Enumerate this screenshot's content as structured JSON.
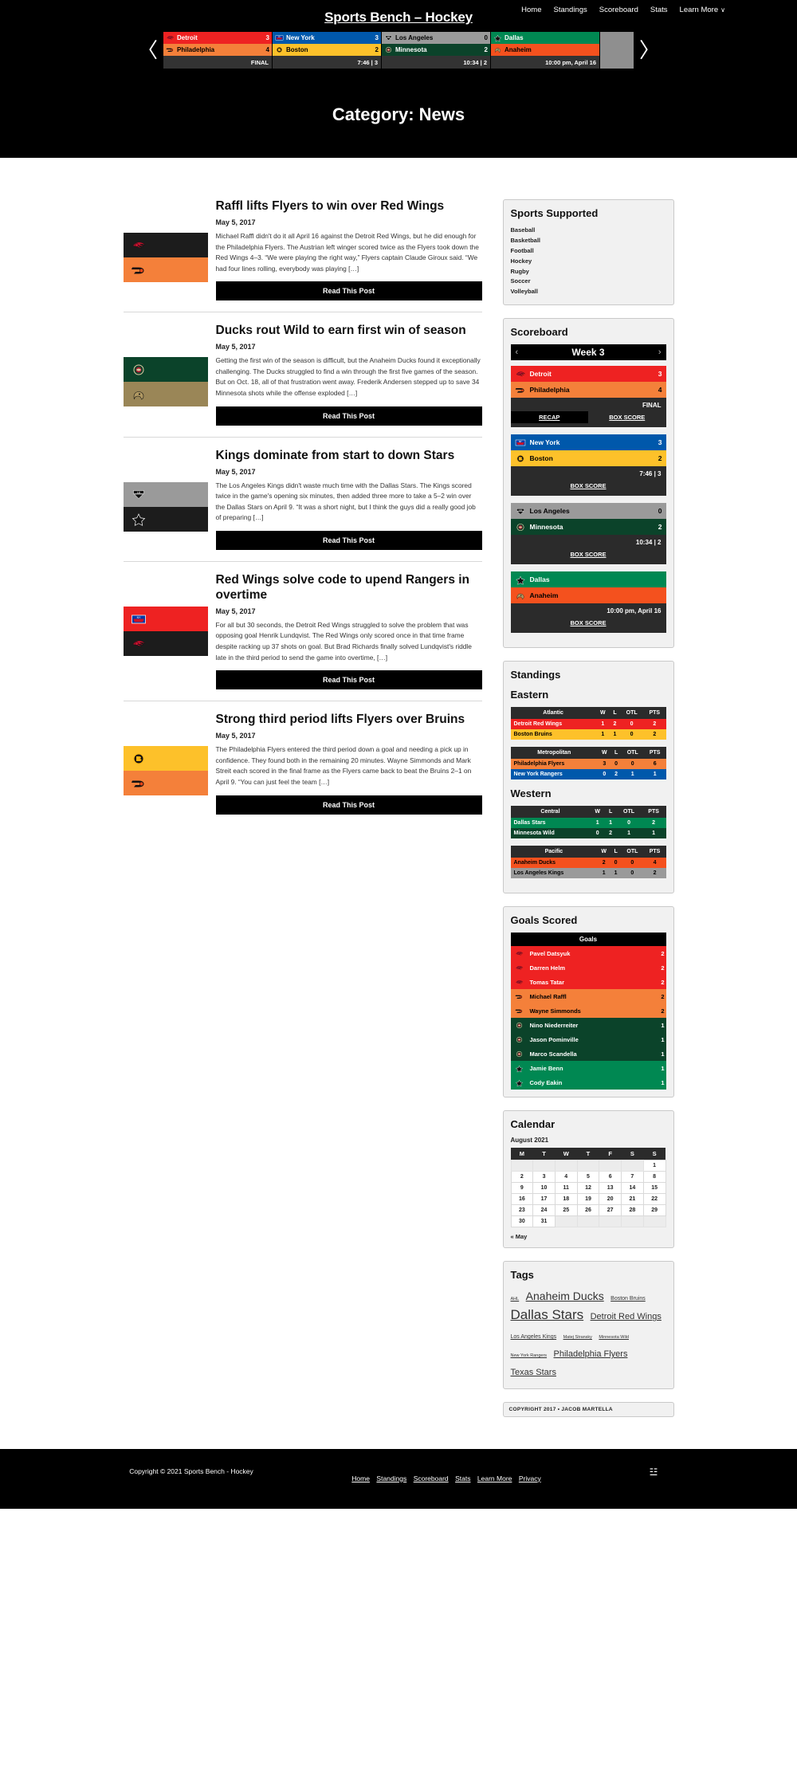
{
  "site": {
    "title": "Sports Bench – Hockey",
    "nav": [
      "Home",
      "Standings",
      "Scoreboard",
      "Stats",
      "Learn More"
    ],
    "nav_caret": "∨"
  },
  "ticker": {
    "prev_icon": "〈",
    "next_icon": "〉",
    "games": [
      {
        "away": {
          "name": "Detroit",
          "score": "3",
          "bg": "#ee2222",
          "fg": "#ffffff",
          "logo": "redwings"
        },
        "home": {
          "name": "Philadelphia",
          "score": "4",
          "bg": "#f4803a",
          "fg": "#000000",
          "logo": "flyers"
        },
        "status": "FINAL"
      },
      {
        "away": {
          "name": "New York",
          "score": "3",
          "bg": "#0058ab",
          "fg": "#ffffff",
          "logo": "rangers"
        },
        "home": {
          "name": "Boston",
          "score": "2",
          "bg": "#fdc12a",
          "fg": "#000000",
          "logo": "bruins"
        },
        "status": "7:46 | 3"
      },
      {
        "away": {
          "name": "Los Angeles",
          "score": "0",
          "bg": "#9a9a9a",
          "fg": "#000000",
          "logo": "kings"
        },
        "home": {
          "name": "Minnesota",
          "score": "2",
          "bg": "#0b432a",
          "fg": "#ffffff",
          "logo": "wild"
        },
        "status": "10:34 | 2"
      },
      {
        "away": {
          "name": "Dallas",
          "score": "",
          "bg": "#008852",
          "fg": "#ffffff",
          "logo": "stars"
        },
        "home": {
          "name": "Anaheim",
          "score": "",
          "bg": "#f4511e",
          "fg": "#000000",
          "logo": "ducks"
        },
        "status": "10:00 pm, April 16"
      }
    ]
  },
  "page": {
    "heading": "Category: News"
  },
  "articles": [
    {
      "title": "Raffl lifts Flyers to win over Red Wings",
      "date": "May 5, 2017",
      "excerpt": "Michael Raffl didn't do it all April 16 against the Detroit Red Wings, but he did enough for the Philadelphia Flyers. The Austrian left winger scored twice as the Flyers took down the Red Wings 4–3. “We were playing the right way,” Flyers captain Claude Giroux said. “We had four lines rolling, everybody was playing […]",
      "button": "Read This Post",
      "thumb": {
        "top_bg": "#1c1c1c",
        "top_logo": "redwings",
        "bottom_bg": "#f4803a",
        "bottom_logo": "flyers"
      }
    },
    {
      "title": "Ducks rout Wild to earn first win of season",
      "date": "May 5, 2017",
      "excerpt": "Getting the first win of the season is difficult, but the Anaheim Ducks found it exceptionally challenging. The Ducks struggled to find a win through the first five games of the season. But on Oct. 18, all of that frustration went away. Frederik Andersen stepped up to save 34 Minnesota shots while the offense exploded […]",
      "button": "Read This Post",
      "thumb": {
        "top_bg": "#0b432a",
        "top_logo": "wild",
        "bottom_bg": "#9a8657",
        "bottom_logo": "ducks"
      }
    },
    {
      "title": "Kings dominate from start to down Stars",
      "date": "May 5, 2017",
      "excerpt": "The Los Angeles Kings didn't waste much time with the Dallas Stars. The Kings scored twice in the game's opening six minutes, then added three more to take a 5–2 win over the Dallas Stars on April 9. “It was a short night, but I think the guys did a really good job of preparing […]",
      "button": "Read This Post",
      "thumb": {
        "top_bg": "#9a9a9a",
        "top_logo": "kings",
        "bottom_bg": "#1c1c1c",
        "bottom_logo": "stars"
      }
    },
    {
      "title": "Red Wings solve code to upend Rangers in overtime",
      "date": "May 5, 2017",
      "excerpt": "For all but 30 seconds, the Detroit Red Wings struggled to solve the problem that was opposing goal Henrik Lundqvist. The Red Wings only scored once in that time frame despite racking up 37 shots on goal. But Brad Richards finally solved Lundqvist's riddle late in the third period to send the game into overtime, […]",
      "button": "Read This Post",
      "thumb": {
        "top_bg": "#ee2222",
        "top_logo": "rangers",
        "bottom_bg": "#1c1c1c",
        "bottom_logo": "redwings"
      }
    },
    {
      "title": "Strong third period lifts Flyers over Bruins",
      "date": "May 5, 2017",
      "excerpt": "The Philadelphia Flyers entered the third period down a goal and needing a pick up in confidence. They found both in the remaining 20 minutes. Wayne Simmonds and Mark Streit each scored in the final frame as the Flyers came back to beat the Bruins 2–1 on April 9. “You can just feel the team […]",
      "button": "Read This Post",
      "thumb": {
        "top_bg": "#fdc12a",
        "top_logo": "bruins",
        "bottom_bg": "#f4803a",
        "bottom_logo": "flyers"
      }
    }
  ],
  "sidebar": {
    "sports_supported": {
      "title": "Sports Supported",
      "items": [
        "Baseball",
        "Basketball",
        "Football",
        "Hockey",
        "Rugby",
        "Soccer",
        "Volleyball"
      ]
    },
    "scoreboard": {
      "title": "Scoreboard",
      "week_label": "Week 3",
      "prev_icon": "‹",
      "next_icon": "›",
      "games": [
        {
          "away": {
            "name": "Detroit",
            "score": "3",
            "bg": "#ee2222",
            "fg": "#ffffff",
            "logo": "redwings"
          },
          "home": {
            "name": "Philadelphia",
            "score": "4",
            "bg": "#f4803a",
            "fg": "#000000",
            "logo": "flyers"
          },
          "status": "FINAL",
          "links": [
            "RECAP",
            "BOX SCORE"
          ],
          "recap_active": true
        },
        {
          "away": {
            "name": "New York",
            "score": "3",
            "bg": "#0058ab",
            "fg": "#ffffff",
            "logo": "rangers"
          },
          "home": {
            "name": "Boston",
            "score": "2",
            "bg": "#fdc12a",
            "fg": "#000000",
            "logo": "bruins"
          },
          "status": "7:46 | 3",
          "links": [
            "BOX SCORE"
          ],
          "recap_active": false
        },
        {
          "away": {
            "name": "Los Angeles",
            "score": "0",
            "bg": "#9a9a9a",
            "fg": "#000000",
            "logo": "kings"
          },
          "home": {
            "name": "Minnesota",
            "score": "2",
            "bg": "#0b432a",
            "fg": "#ffffff",
            "logo": "wild"
          },
          "status": "10:34 | 2",
          "links": [
            "BOX SCORE"
          ],
          "recap_active": false
        },
        {
          "away": {
            "name": "Dallas",
            "score": "",
            "bg": "#008852",
            "fg": "#ffffff",
            "logo": "stars"
          },
          "home": {
            "name": "Anaheim",
            "score": "",
            "bg": "#f4511e",
            "fg": "#000000",
            "logo": "ducks"
          },
          "status": "10:00 pm, April 16",
          "links": [
            "BOX SCORE"
          ],
          "recap_active": false
        }
      ]
    },
    "standings": {
      "title": "Standings",
      "columns": [
        "W",
        "L",
        "OTL",
        "PTS"
      ],
      "conferences": [
        {
          "name": "Eastern",
          "divisions": [
            {
              "name": "Atlantic",
              "teams": [
                {
                  "name": "Detroit Red Wings",
                  "w": "1",
                  "l": "2",
                  "otl": "0",
                  "pts": "2",
                  "bg": "#ee2222",
                  "fg": "#ffffff"
                },
                {
                  "name": "Boston Bruins",
                  "w": "1",
                  "l": "1",
                  "otl": "0",
                  "pts": "2",
                  "bg": "#fdc12a",
                  "fg": "#000000"
                }
              ]
            },
            {
              "name": "Metropolitan",
              "teams": [
                {
                  "name": "Philadelphia Flyers",
                  "w": "3",
                  "l": "0",
                  "otl": "0",
                  "pts": "6",
                  "bg": "#f4803a",
                  "fg": "#000000"
                },
                {
                  "name": "New York Rangers",
                  "w": "0",
                  "l": "2",
                  "otl": "1",
                  "pts": "1",
                  "bg": "#0058ab",
                  "fg": "#ffffff"
                }
              ]
            }
          ]
        },
        {
          "name": "Western",
          "divisions": [
            {
              "name": "Central",
              "teams": [
                {
                  "name": "Dallas Stars",
                  "w": "1",
                  "l": "1",
                  "otl": "0",
                  "pts": "2",
                  "bg": "#008852",
                  "fg": "#ffffff"
                },
                {
                  "name": "Minnesota Wild",
                  "w": "0",
                  "l": "2",
                  "otl": "1",
                  "pts": "1",
                  "bg": "#0b432a",
                  "fg": "#ffffff"
                }
              ]
            },
            {
              "name": "Pacific",
              "teams": [
                {
                  "name": "Anaheim Ducks",
                  "w": "2",
                  "l": "0",
                  "otl": "0",
                  "pts": "4",
                  "bg": "#f4511e",
                  "fg": "#000000"
                },
                {
                  "name": "Los Angeles Kings",
                  "w": "1",
                  "l": "1",
                  "otl": "0",
                  "pts": "2",
                  "bg": "#9a9a9a",
                  "fg": "#000000"
                }
              ]
            }
          ]
        }
      ]
    },
    "goals_scored": {
      "title": "Goals Scored",
      "column_header": "Goals",
      "players": [
        {
          "name": "Pavel Datsyuk",
          "goals": "2",
          "bg": "#ee2222",
          "fg": "#ffffff",
          "logo": "redwings"
        },
        {
          "name": "Darren Helm",
          "goals": "2",
          "bg": "#ee2222",
          "fg": "#ffffff",
          "logo": "redwings"
        },
        {
          "name": "Tomas Tatar",
          "goals": "2",
          "bg": "#ee2222",
          "fg": "#ffffff",
          "logo": "redwings"
        },
        {
          "name": "Michael Raffl",
          "goals": "2",
          "bg": "#f4803a",
          "fg": "#000000",
          "logo": "flyers"
        },
        {
          "name": "Wayne Simmonds",
          "goals": "2",
          "bg": "#f4803a",
          "fg": "#000000",
          "logo": "flyers"
        },
        {
          "name": "Nino Niederreiter",
          "goals": "1",
          "bg": "#0b432a",
          "fg": "#ffffff",
          "logo": "wild"
        },
        {
          "name": "Jason Pominville",
          "goals": "1",
          "bg": "#0b432a",
          "fg": "#ffffff",
          "logo": "wild"
        },
        {
          "name": "Marco Scandella",
          "goals": "1",
          "bg": "#0b432a",
          "fg": "#ffffff",
          "logo": "wild"
        },
        {
          "name": "Jamie Benn",
          "goals": "1",
          "bg": "#008852",
          "fg": "#ffffff",
          "logo": "stars"
        },
        {
          "name": "Cody Eakin",
          "goals": "1",
          "bg": "#008852",
          "fg": "#ffffff",
          "logo": "stars"
        }
      ]
    },
    "calendar": {
      "title": "Calendar",
      "month": "August 2021",
      "weekdays": [
        "M",
        "T",
        "W",
        "T",
        "F",
        "S",
        "S"
      ],
      "weeks": [
        [
          "",
          "",
          "",
          "",
          "",
          "",
          "1"
        ],
        [
          "2",
          "3",
          "4",
          "5",
          "6",
          "7",
          "8"
        ],
        [
          "9",
          "10",
          "11",
          "12",
          "13",
          "14",
          "15"
        ],
        [
          "16",
          "17",
          "18",
          "19",
          "20",
          "21",
          "22"
        ],
        [
          "23",
          "24",
          "25",
          "26",
          "27",
          "28",
          "29"
        ],
        [
          "30",
          "31",
          "",
          "",
          "",
          "",
          ""
        ]
      ],
      "prev_link": "« May"
    },
    "tags": {
      "title": "Tags",
      "items": [
        {
          "label": "AHL",
          "size": "tag-xs"
        },
        {
          "label": "Anaheim Ducks",
          "size": "tag-l"
        },
        {
          "label": "Boston Bruins",
          "size": "tag-s"
        },
        {
          "label": "Dallas Stars",
          "size": "tag-xl"
        },
        {
          "label": "Detroit Red Wings",
          "size": "tag-m"
        },
        {
          "label": "Los Angeles Kings",
          "size": "tag-s"
        },
        {
          "label": "Matej Stransky",
          "size": "tag-xs"
        },
        {
          "label": "Minnesota Wild",
          "size": "tag-xs"
        },
        {
          "label": "New York Rangers",
          "size": "tag-xs"
        },
        {
          "label": "Philadelphia Flyers",
          "size": "tag-m"
        },
        {
          "label": "Texas Stars",
          "size": "tag-m"
        }
      ]
    },
    "copyright_box": "COPYRIGHT 2017 • JACOB MARTELLA"
  },
  "footer": {
    "copyright": "Copyright © 2021 Sports Bench - Hockey",
    "nav": [
      "Home",
      "Standings",
      "Scoreboard",
      "Stats",
      "Learn More",
      "Privacy"
    ],
    "social_icon": "☳"
  }
}
